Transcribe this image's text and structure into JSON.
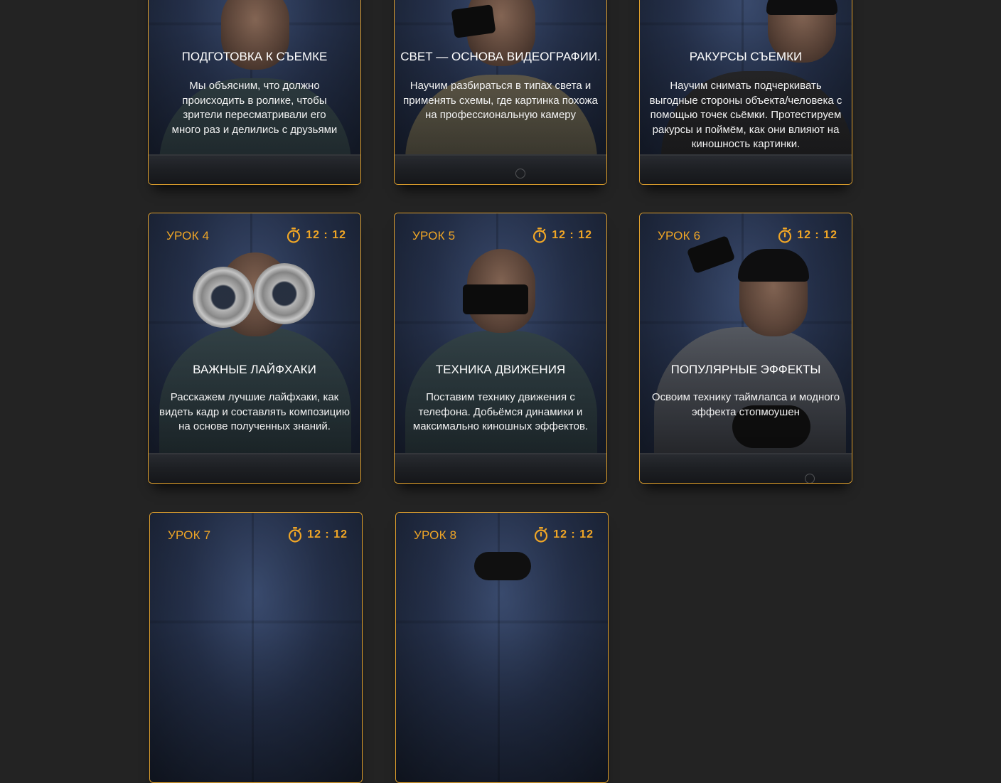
{
  "cards": [
    {
      "title": "ПОДГОТОВКА К СЪЕМКЕ",
      "description": "Мы объясним, что должно происходить в ролике, чтобы зрители пересматривали его много раз и делились с друзьями"
    },
    {
      "title": "СВЕТ — ОСНОВА ВИДЕОГРАФИИ.",
      "description": "Научим разбираться в типах света и применять схемы, где картинка похожа на профессиональную камеру"
    },
    {
      "title": "РАКУРСЫ СЪЕМКИ",
      "description": "Научим снимать подчеркивать выгодные стороны объекта/человека с помощью точек сьёмки. Протестируем ракурсы и поймём, как они влияют на киношность картинки."
    },
    {
      "lesson": "УРОК 4",
      "duration": "12 : 12",
      "title": "ВАЖНЫЕ ЛАЙФХАКИ",
      "description": "Расскажем лучшие лайфхаки, как видеть кадр и составлять композицию на основе полученных знаний."
    },
    {
      "lesson": "УРОК 5",
      "duration": "12 : 12",
      "title": "ТЕХНИКА ДВИЖЕНИЯ",
      "description": "Поставим технику движения с телефона. Добьёмся динамики и максимально киношных эффектов."
    },
    {
      "lesson": "УРОК 6",
      "duration": "12 : 12",
      "title": "ПОПУЛЯРНЫЕ ЭФФЕКТЫ",
      "description": "Освоим технику таймлапса и модного эффекта стопмоушен"
    },
    {
      "lesson": "УРОК 7",
      "duration": "12 : 12"
    },
    {
      "lesson": "УРОК 8",
      "duration": "12 : 12"
    }
  ],
  "colors": {
    "accent": "#f0a626",
    "background": "#232323"
  },
  "icons": {
    "timer": "stopwatch-icon",
    "zoom": "zoom-icon"
  }
}
